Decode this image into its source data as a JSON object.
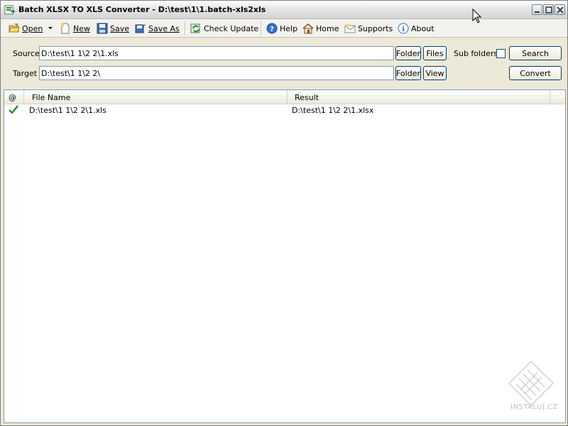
{
  "window": {
    "title": "Batch XLSX TO XLS Converter - D:\\test\\1\\1.batch-xls2xls"
  },
  "toolbar": {
    "open": "Open",
    "new": "New",
    "save": "Save",
    "save_as": "Save As",
    "check_update": "Check Update",
    "help": "Help",
    "home": "Home",
    "supports": "Supports",
    "about": "About"
  },
  "form": {
    "source_label": "Source",
    "source_value": "D:\\test\\1 1\\2 2\\1.xls",
    "target_label": "Target",
    "target_value": "D:\\test\\1 1\\2 2\\",
    "folder_label": "Folder",
    "files_label": "Files",
    "view_label": "View",
    "subfolders_label": "Sub folders",
    "search_label": "Search",
    "convert_label": "Convert"
  },
  "list": {
    "columns": [
      "@",
      "File Name",
      "Result"
    ],
    "rows": [
      {
        "status": "success",
        "file": "D:\\test\\1 1\\2 2\\1.xls",
        "result": "D:\\test\\1 1\\2 2\\1.xlsx"
      }
    ]
  },
  "watermark": {
    "text": "INSTALUJ.CZ"
  },
  "colors": {
    "check_green": "#2e8b2e",
    "field_border": "#7f9db9",
    "button_border": "#003c74"
  }
}
